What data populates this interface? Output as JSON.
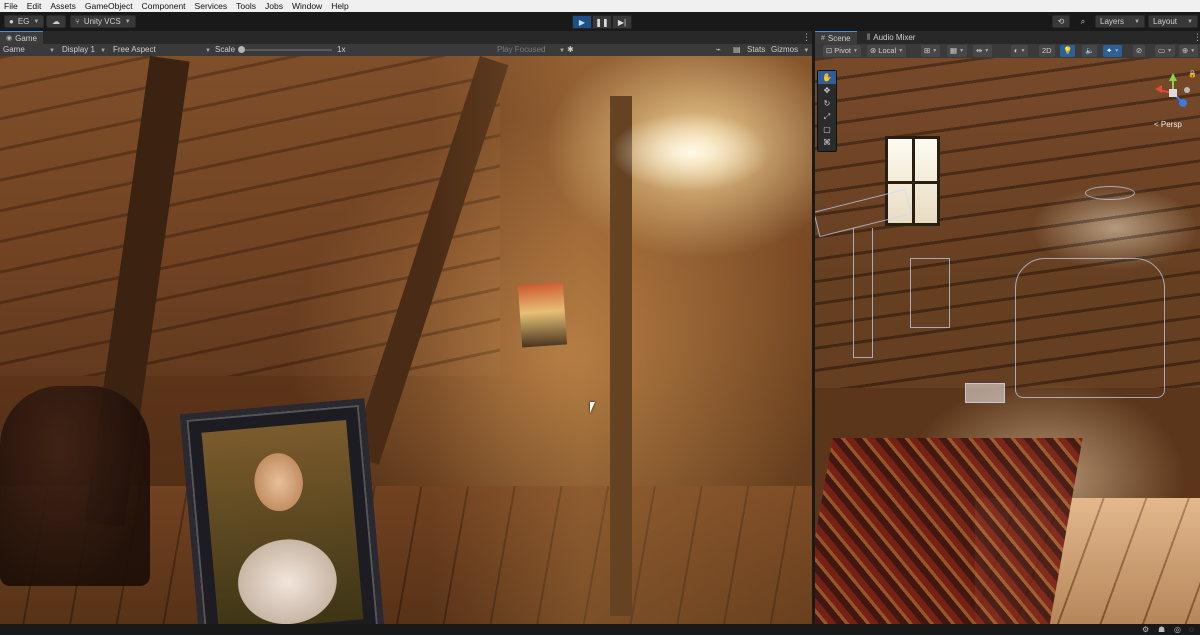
{
  "menu": [
    "File",
    "Edit",
    "Assets",
    "GameObject",
    "Component",
    "Services",
    "Tools",
    "Jobs",
    "Window",
    "Help"
  ],
  "toolbar": {
    "account": "EG",
    "vcs": "Unity VCS",
    "layers": "Layers",
    "layout": "Layout"
  },
  "game_panel": {
    "tab": "Game",
    "view_mode": "Game",
    "display": "Display 1",
    "aspect": "Free Aspect",
    "scale_label": "Scale",
    "scale_value": "1x",
    "play_focused": "Play Focused",
    "stats": "Stats",
    "gizmos": "Gizmos"
  },
  "scene_panel": {
    "tab_scene": "Scene",
    "tab_audio": "Audio Mixer",
    "pivot": "Pivot",
    "local": "Local",
    "mode_2d": "2D",
    "persp": "< Persp"
  },
  "colors": {
    "accent": "#2f5f99",
    "play_active": "#1e4f86",
    "panel_bg": "#282828",
    "menubar_bg": "#f0f0f0"
  }
}
